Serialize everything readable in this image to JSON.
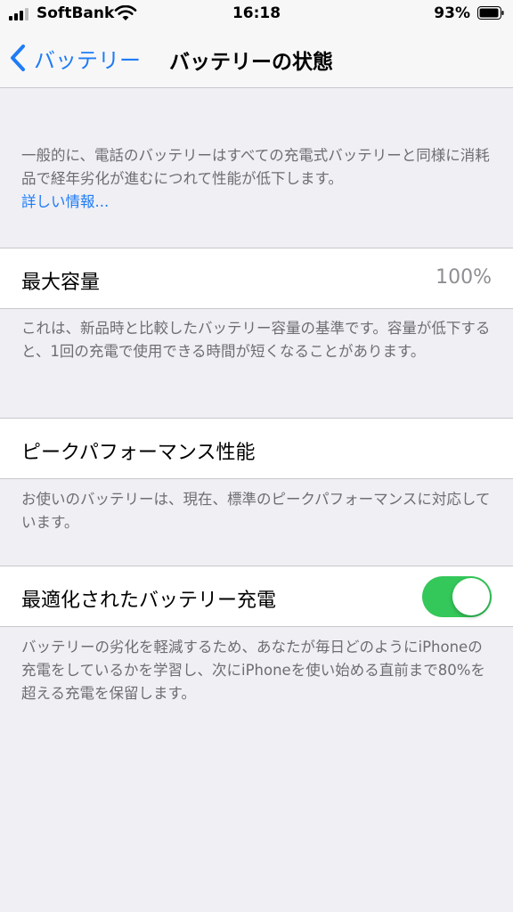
{
  "status_bar": {
    "carrier": "SoftBank",
    "time": "16:18",
    "battery_percent": "93%"
  },
  "nav": {
    "back_label": "バッテリー",
    "title": "バッテリーの状態"
  },
  "intro": {
    "text": "一般的に、電話のバッテリーはすべての充電式バッテリーと同様に消耗品で経年劣化が進むにつれて性能が低下します。",
    "link": "詳しい情報..."
  },
  "max_capacity": {
    "label": "最大容量",
    "value": "100%",
    "footer": "これは、新品時と比較したバッテリー容量の基準です。容量が低下すると、1回の充電で使用できる時間が短くなることがあります。"
  },
  "peak_performance": {
    "label": "ピークパフォーマンス性能",
    "footer": "お使いのバッテリーは、現在、標準のピークパフォーマンスに対応しています。"
  },
  "optimized_charging": {
    "label": "最適化されたバッテリー充電",
    "enabled": true,
    "footer": "バッテリーの劣化を軽減するため、あなたが毎日どのようにiPhoneの充電をしているかを学習し、次にiPhoneを使い始める直前まで80%を超える充電を保留します。"
  },
  "colors": {
    "accent": "#1f7cf6",
    "toggle_on": "#34c759",
    "background": "#efeff4"
  }
}
